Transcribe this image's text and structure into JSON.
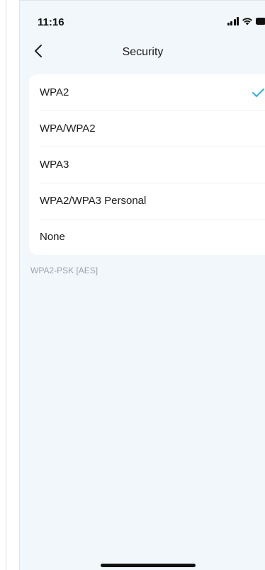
{
  "status_bar": {
    "time": "11:16",
    "icons": [
      "signal-icon",
      "wifi-icon",
      "battery-icon"
    ]
  },
  "nav": {
    "back_icon": "chevron-left-icon",
    "title": "Security"
  },
  "security_options": [
    {
      "label": "WPA2",
      "selected": true
    },
    {
      "label": "WPA/WPA2",
      "selected": false
    },
    {
      "label": "WPA3",
      "selected": false
    },
    {
      "label": "WPA2/WPA3 Personal",
      "selected": false
    },
    {
      "label": "None",
      "selected": false
    }
  ],
  "footnote": "WPA2-PSK [AES]",
  "colors": {
    "background": "#f2f7fb",
    "card": "#ffffff",
    "check_accent": "#2bb3e6",
    "footnote_text": "#9aa3ad"
  }
}
